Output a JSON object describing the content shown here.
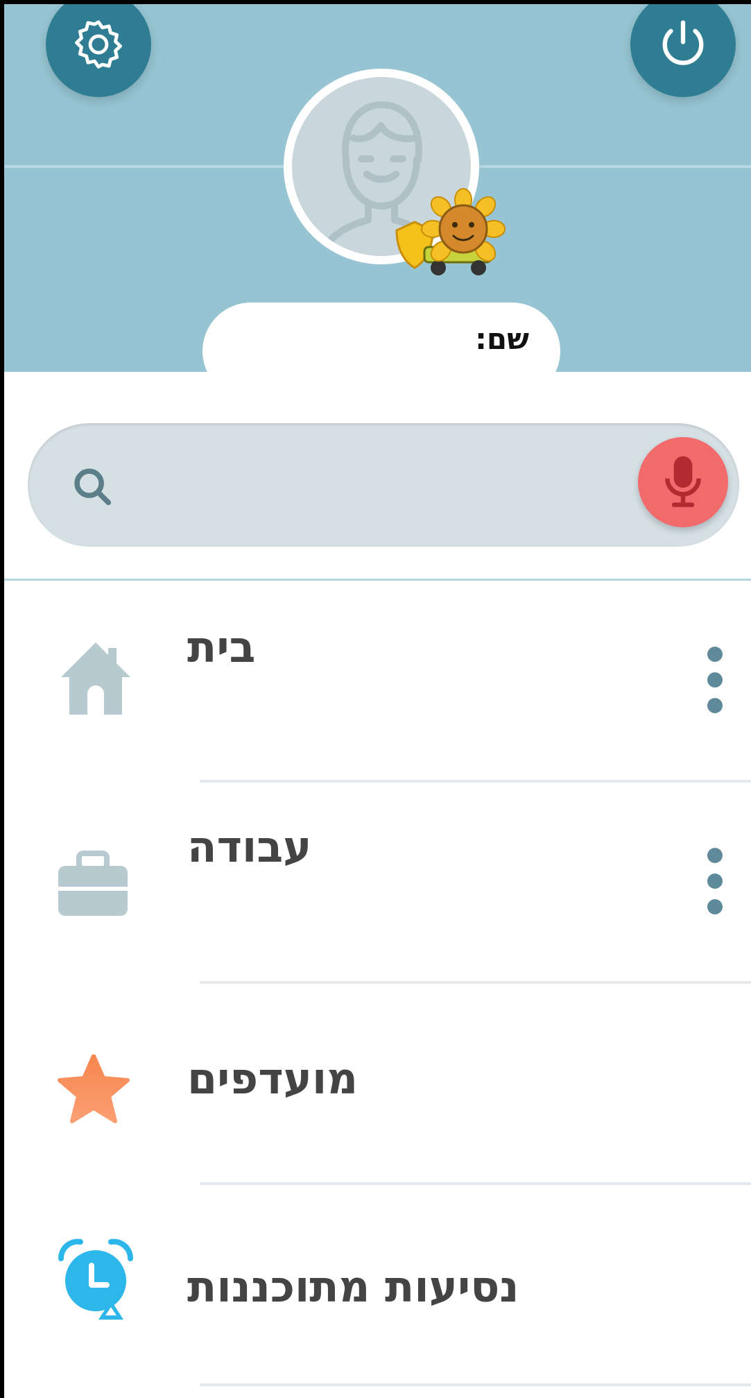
{
  "header": {
    "settings_icon": "gear-icon",
    "power_icon": "power-icon",
    "name_label": "שם:",
    "mood_icon": "sunflower-mood-icon"
  },
  "search": {
    "placeholder": "",
    "search_icon": "search-icon",
    "voice_icon": "microphone-icon"
  },
  "menu": {
    "items": [
      {
        "label": "בית",
        "icon": "home-icon"
      },
      {
        "label": "עבודה",
        "icon": "briefcase-icon"
      },
      {
        "label": "מועדפים",
        "icon": "star-icon"
      },
      {
        "label": "נסיעות מתוכננות",
        "icon": "alarm-clock-icon"
      }
    ]
  },
  "colors": {
    "header_bg": "#96c4d2",
    "circle_button": "#2f7d92",
    "mic_button": "#f16a6c",
    "star": "#f78f5f",
    "alarm": "#2cb6ea"
  }
}
